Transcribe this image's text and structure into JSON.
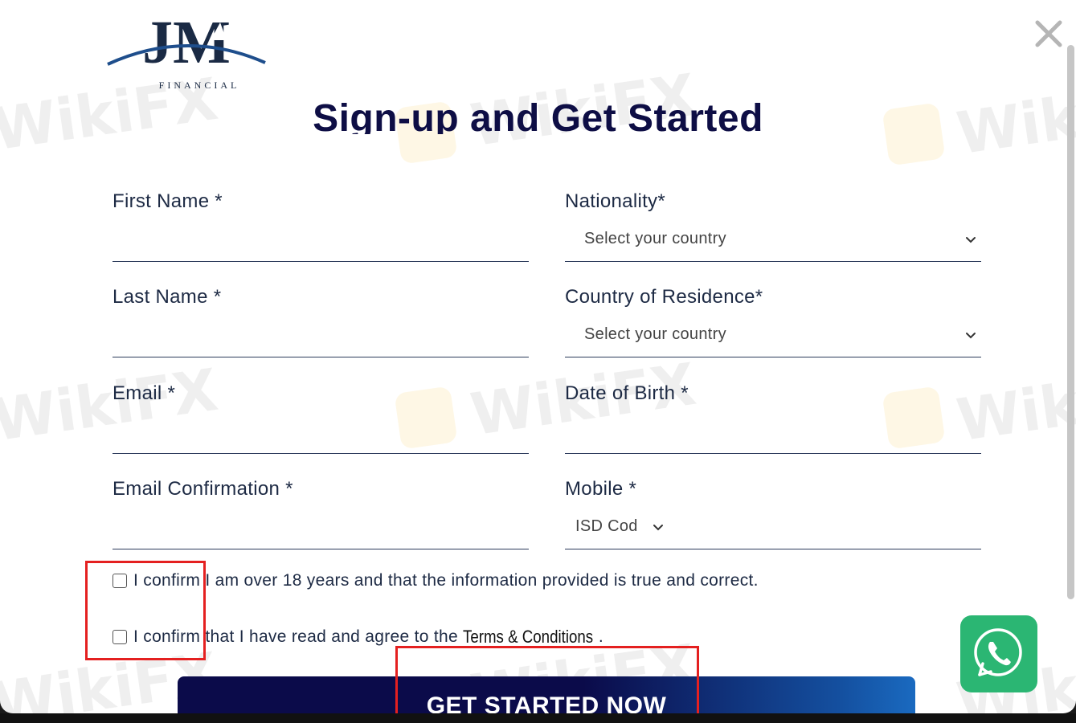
{
  "brand": {
    "logo_letters": "JM",
    "logo_subtext": "FINANCIAL",
    "primary_color": "#0e0e45",
    "accent_color": "#1a6ac0"
  },
  "watermark": {
    "text": "WikiFX"
  },
  "heading": {
    "title": "Sign-up and Get Started"
  },
  "form": {
    "first_name": {
      "label": "First Name *",
      "value": ""
    },
    "last_name": {
      "label": "Last Name *",
      "value": ""
    },
    "email": {
      "label": "Email *",
      "value": ""
    },
    "email_confirmation": {
      "label": "Email Confirmation *",
      "value": ""
    },
    "nationality": {
      "label": "Nationality*",
      "selected": "Select your country"
    },
    "country_of_residence": {
      "label": "Country of Residence*",
      "selected": "Select your country"
    },
    "date_of_birth": {
      "label": "Date of Birth *",
      "value": ""
    },
    "mobile": {
      "label": "Mobile *",
      "isd_selected": "ISD Cod",
      "value": ""
    }
  },
  "checkboxes": {
    "age_confirm": "I confirm I am over 18 years and that the information provided is true and correct.",
    "terms_prefix": "I confirm that I have read and agree to the ",
    "terms_link": "Terms & Conditions",
    "terms_suffix": "."
  },
  "cta": {
    "label": "GET STARTED NOW"
  },
  "icons": {
    "close": "close-icon",
    "chevron": "chevron-down-icon",
    "whatsapp": "whatsapp-icon",
    "whatsapp_color": "#2bb673"
  }
}
